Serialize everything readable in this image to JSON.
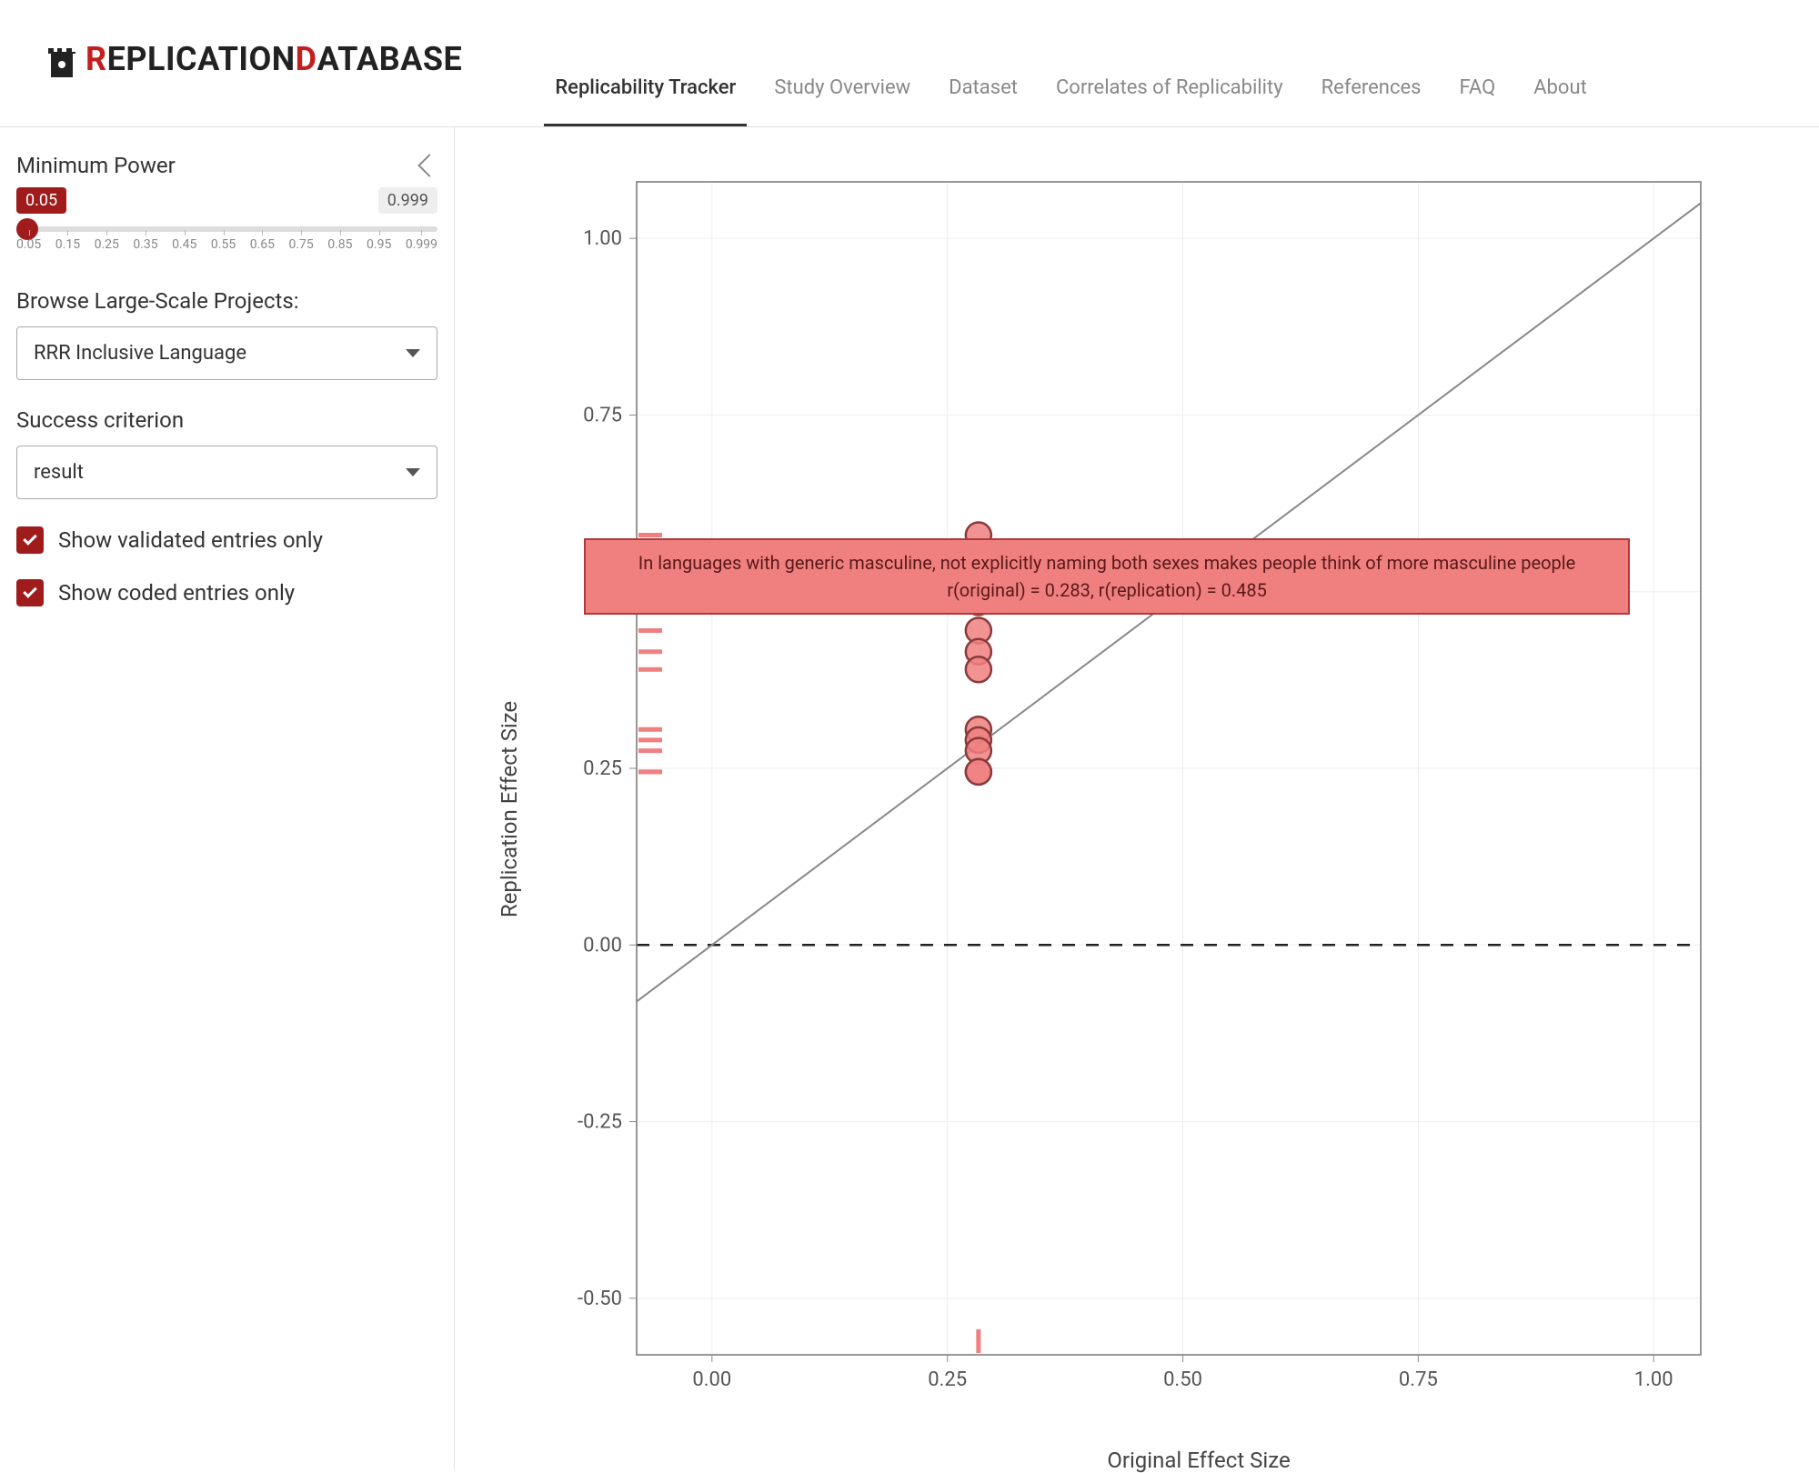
{
  "logo": {
    "text_r": "R",
    "text_eplication": "EPLICATION ",
    "text_d": "D",
    "text_atabase": "ATABASE"
  },
  "nav": {
    "items": [
      "Replicability Tracker",
      "Study Overview",
      "Dataset",
      "Correlates of Replicability",
      "References",
      "FAQ",
      "About"
    ],
    "active_index": 0
  },
  "sidebar": {
    "min_power_label": "Minimum Power",
    "slider": {
      "value": "0.05",
      "max_label": "0.999",
      "ticks": [
        "0.05",
        "0.15",
        "0.25",
        "0.35",
        "0.45",
        "0.55",
        "0.65",
        "0.75",
        "0.85",
        "0.95",
        "0.999"
      ]
    },
    "browse_label": "Browse Large-Scale Projects:",
    "project_select": "RRR Inclusive Language",
    "criterion_label": "Success criterion",
    "criterion_select": "result",
    "cb_validated": "Show validated entries only",
    "cb_coded": "Show coded entries only"
  },
  "chart_data": {
    "type": "scatter",
    "xlabel": "Original Effect Size",
    "ylabel": "Replication Effect Size",
    "xlim": [
      -0.08,
      1.05
    ],
    "ylim": [
      -0.58,
      1.08
    ],
    "xticks": [
      0.0,
      0.25,
      0.5,
      0.75,
      1.0
    ],
    "yticks": [
      -0.5,
      -0.25,
      0.0,
      0.25,
      0.5,
      0.75,
      1.0
    ],
    "identity_line": true,
    "zero_line_y": 0.0,
    "series": [
      {
        "name": "replications",
        "color": "#f08080",
        "stroke": "#8b3a3a",
        "points": [
          {
            "x": 0.283,
            "y": 0.58
          },
          {
            "x": 0.283,
            "y": 0.485
          },
          {
            "x": 0.283,
            "y": 0.445
          },
          {
            "x": 0.283,
            "y": 0.415
          },
          {
            "x": 0.283,
            "y": 0.39
          },
          {
            "x": 0.283,
            "y": 0.305
          },
          {
            "x": 0.283,
            "y": 0.29
          },
          {
            "x": 0.283,
            "y": 0.275
          },
          {
            "x": 0.283,
            "y": 0.245
          },
          {
            "x": 0.283,
            "y": 0.245
          }
        ]
      }
    ],
    "rug_y": [
      0.58,
      0.485,
      0.445,
      0.415,
      0.39,
      0.305,
      0.29,
      0.275,
      0.245,
      0.245
    ],
    "rug_x": [
      0.283
    ],
    "tooltip": {
      "line1": "In languages with generic masculine, not explicitly naming both sexes makes people think of more masculine people",
      "line2": "r(original) = 0.283, r(replication) = 0.485"
    }
  },
  "colors": {
    "brand": "#a01c1c",
    "point_fill": "#f08080",
    "point_stroke": "#8b3a3a"
  }
}
